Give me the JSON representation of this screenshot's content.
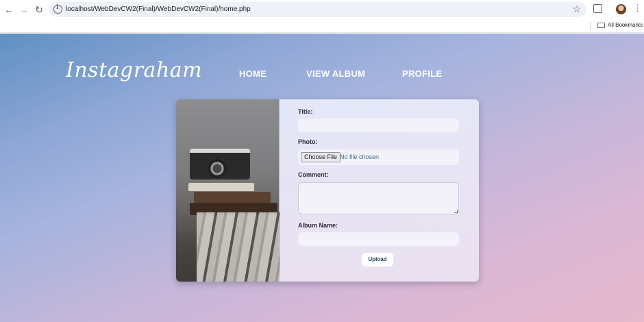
{
  "browser": {
    "url": "localhost/WebDevCW2(Final)/WebDevCW2(Final)/home.php",
    "bookmarks_label": "All Bookmarks"
  },
  "site": {
    "logo": "Instagraham",
    "nav": {
      "home": "HOME",
      "view_album": "VIEW ALBUM",
      "profile": "PROFILE"
    }
  },
  "form": {
    "title_label": "Title:",
    "title_value": "",
    "photo_label": "Photo:",
    "choose_file_label": "Choose File",
    "no_file_text": "No file chosen",
    "comment_label": "Comment:",
    "comment_value": "",
    "album_label": "Album Name:",
    "album_value": "",
    "upload_label": "Upload"
  }
}
